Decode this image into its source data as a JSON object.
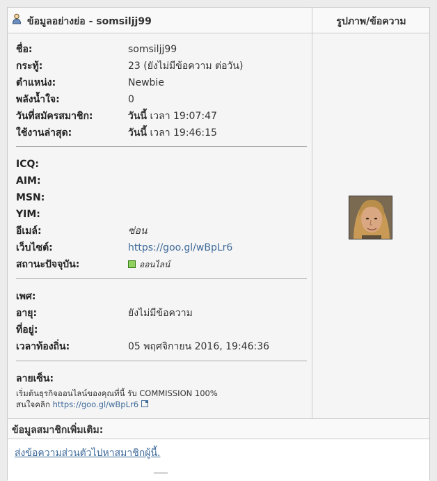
{
  "header": {
    "title": "ข้อมูลอย่างย่อ - somsiljj99",
    "right_title": "รูปภาพ/ข้อความ"
  },
  "profile": {
    "rows": [
      {
        "label": "ชื่อ:",
        "value": "somsiljj99"
      },
      {
        "label": "กระทู้:",
        "value": "23 (ยังไม่มีข้อความ ต่อวัน)"
      },
      {
        "label": "ตำแหน่ง:",
        "value": "Newbie"
      },
      {
        "label": "พลังน้ำใจ:",
        "value": "0"
      },
      {
        "label": "วันที่สมัครสมาชิก:",
        "value_bold": "วันนี้",
        "value": "เวลา 19:07:47"
      },
      {
        "label": "ใช้งานล่าสุด:",
        "value_bold": "วันนี้",
        "value": "เวลา 19:46:15"
      }
    ]
  },
  "contact": {
    "icq": "ICQ:",
    "aim": "AIM:",
    "msn": "MSN:",
    "yim": "YIM:",
    "email_label": "อีเมล์:",
    "email_value": "ซ่อน",
    "website_label": "เว็บไซต์:",
    "website_value": "https://goo.gl/wBpLr6",
    "status_label": "สถานะปัจจุบัน:",
    "status_value": "ออนไลน์",
    "status_color": "#8fd35e"
  },
  "personal": {
    "gender_label": "เพศ:",
    "age_label": "อายุ:",
    "age_value": "ยังไม่มีข้อความ",
    "location_label": "ที่อยู่:",
    "localtime_label": "เวลาท้องถิ่น:",
    "localtime_value": "05 พฤศจิกายน 2016, 19:46:36"
  },
  "signature": {
    "label": "ลายเซ็น:",
    "line1": "เริ่มต้นธุรกิจออนไลน์ของคุณที่นี้ รับ COMMISSION 100%",
    "line2_prefix": "สนใจคลิก",
    "link": "https://goo.gl/wBpLr6"
  },
  "more": {
    "title": "ข้อมูลสมาชิกเพิ่มเติม:",
    "pm_link": "ส่งข้อความส่วนตัวไปหาสมาชิกผู้นี้."
  },
  "colors": {
    "link": "#3e6a9a",
    "border": "#c9c9c9",
    "background": "#f5f5f5"
  },
  "icons": [
    "user-icon",
    "status-online-icon",
    "external-link-icon",
    "avatar"
  ]
}
